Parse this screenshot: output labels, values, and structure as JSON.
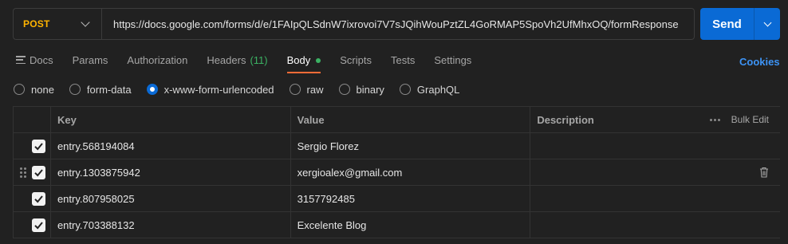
{
  "request": {
    "method": "POST",
    "url": "https://docs.google.com/forms/d/e/1FAIpQLSdnW7ixrovoi7V7sJQihWouPztZL4GoRMAP5SpoVh2UfMhxOQ/formResponse",
    "send_label": "Send"
  },
  "tabs": [
    {
      "label": "Docs",
      "icon": "docs-icon"
    },
    {
      "label": "Params"
    },
    {
      "label": "Authorization"
    },
    {
      "label": "Headers",
      "count": "(11)"
    },
    {
      "label": "Body",
      "active": true
    },
    {
      "label": "Scripts"
    },
    {
      "label": "Tests"
    },
    {
      "label": "Settings"
    }
  ],
  "cookies_label": "Cookies",
  "body_types": [
    {
      "label": "none",
      "checked": false
    },
    {
      "label": "form-data",
      "checked": false
    },
    {
      "label": "x-www-form-urlencoded",
      "checked": true
    },
    {
      "label": "raw",
      "checked": false
    },
    {
      "label": "binary",
      "checked": false
    },
    {
      "label": "GraphQL",
      "checked": false
    }
  ],
  "table": {
    "headers": {
      "key": "Key",
      "value": "Value",
      "description": "Description",
      "bulk_edit": "Bulk Edit"
    },
    "rows": [
      {
        "key": "entry.568194084",
        "value": "Sergio Florez",
        "description": "",
        "checked": true
      },
      {
        "key": "entry.1303875942",
        "value": "xergioalex@gmail.com",
        "description": "",
        "checked": true
      },
      {
        "key": "entry.807958025",
        "value": "3157792485",
        "description": "",
        "checked": true
      },
      {
        "key": "entry.703388132",
        "value": "Excelente Blog",
        "description": "",
        "checked": true
      }
    ]
  },
  "colors": {
    "method": "#ffb400",
    "send": "#0a6ad5",
    "active_tab_underline": "#ff6c37",
    "body_dot": "#3bb263",
    "cookies": "#3d94f6"
  }
}
